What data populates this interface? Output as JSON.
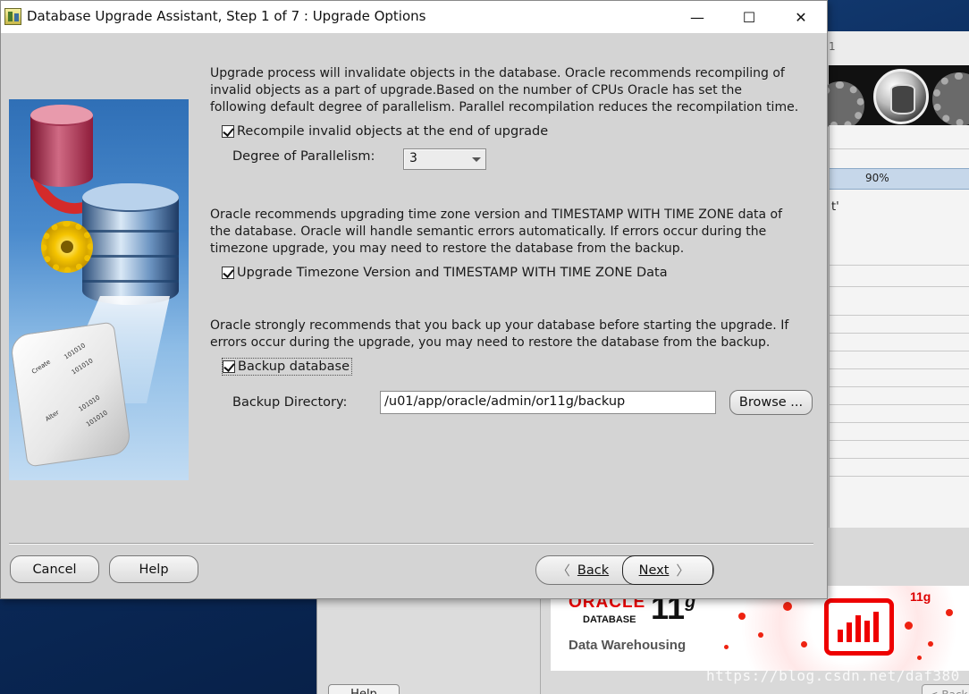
{
  "dialog": {
    "title": "Database Upgrade Assistant, Step 1 of 7 : Upgrade Options",
    "window_controls": {
      "minimize": "—",
      "maximize": "☐",
      "close": "✕"
    }
  },
  "illustration": {
    "scroll_words": [
      "Create",
      "Alter"
    ],
    "scroll_numbers": [
      "101010",
      "101010",
      "101010",
      "101010"
    ]
  },
  "recompile": {
    "description": [
      "Upgrade process will invalidate objects in the database. Oracle recommends recompiling of",
      "invalid objects as a part of upgrade.Based on the number of CPUs Oracle has set the",
      "following default degree of parallelism. Parallel recompilation reduces the recompilation time."
    ],
    "checkbox_label": "Recompile invalid objects at the end of upgrade",
    "checked": true,
    "parallelism_label": "Degree of Parallelism:",
    "parallelism_value": "3"
  },
  "timezone": {
    "description": [
      "Oracle recommends upgrading time zone version and TIMESTAMP WITH TIME ZONE data of",
      "the database. Oracle will handle semantic errors automatically. If errors occur during the",
      "timezone upgrade, you may need to restore the database from the backup."
    ],
    "checkbox_label": "Upgrade Timezone Version and TIMESTAMP WITH TIME ZONE Data",
    "checked": true
  },
  "backup": {
    "description": [
      "Oracle strongly recommends that you back up your database before starting the upgrade. If",
      "errors occur during the upgrade, you may need to restore the database from the backup."
    ],
    "checkbox_label": "Backup database",
    "checked": true,
    "directory_label": "Backup Directory:",
    "directory_value": "/u01/app/oracle/admin/or11g/backup",
    "browse_label": "Browse ..."
  },
  "footer": {
    "cancel_label": "Cancel",
    "help_label": "Help",
    "back_label": "Back",
    "next_label": "Next",
    "back_chevron": "〈",
    "next_chevron": "〉"
  },
  "background_window": {
    "top_digit": "1",
    "progress_text": "90%",
    "fragment_text": "t'",
    "help_label": "Help",
    "back_label": "< Back"
  },
  "banner": {
    "brand": "ORACLE",
    "product": "DATABASE",
    "version": "11",
    "version_suffix": "g",
    "edition": "Data Warehousing",
    "corner_text": "11g"
  },
  "watermark": "https://blog.csdn.net/daf380",
  "colors": {
    "dialog_bg": "#d4d4d4",
    "oracle_red": "#e00000",
    "illustration_blue": "#4b8bcd"
  }
}
